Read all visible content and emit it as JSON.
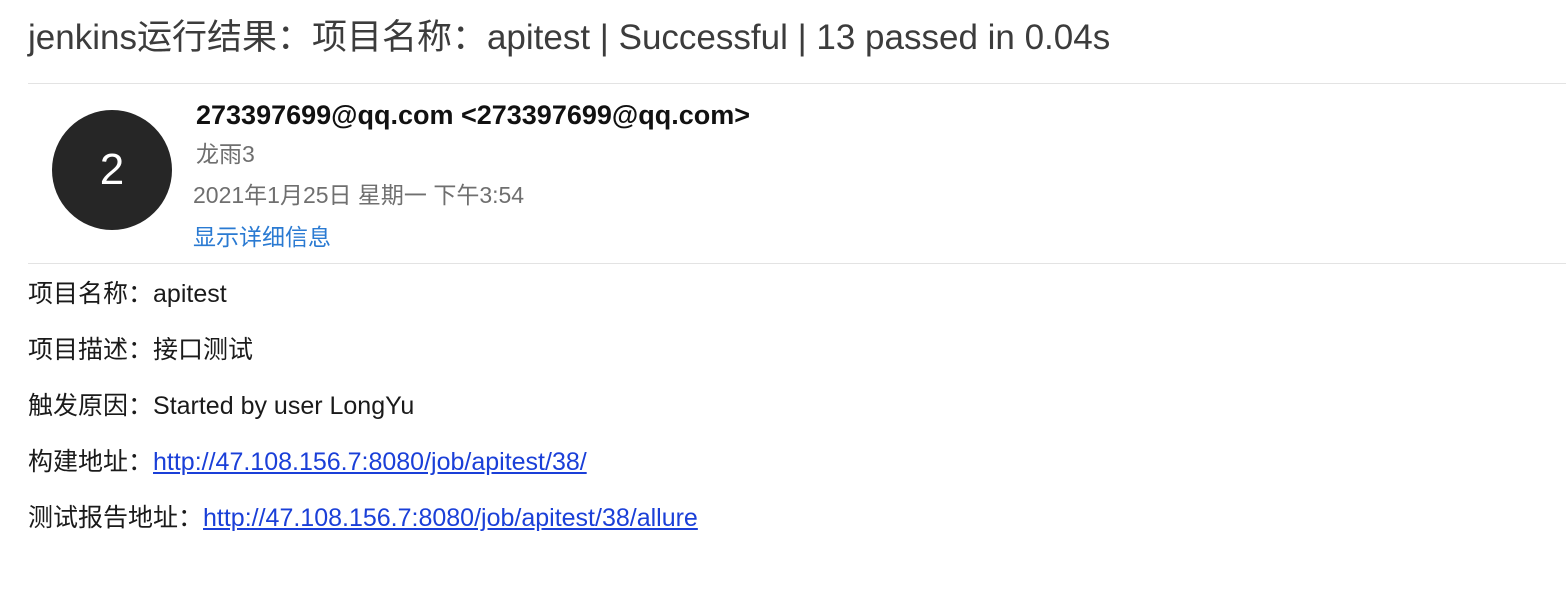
{
  "email": {
    "subject": "jenkins运行结果：项目名称：apitest | Successful | 13 passed in 0.04s",
    "avatar_initial": "2",
    "sender": "273397699@qq.com <273397699@qq.com>",
    "recipient": "龙雨3",
    "date": "2021年1月25日 星期一 下午3:54",
    "show_details_label": "显示详细信息"
  },
  "body": {
    "project_name": {
      "label": "项目名称：",
      "value": "apitest"
    },
    "project_desc": {
      "label": "项目描述：",
      "value": "接口测试"
    },
    "trigger": {
      "label": "触发原因：",
      "value": "Started by user LongYu"
    },
    "build_url": {
      "label": "构建地址：",
      "value": "http://47.108.156.7:8080/job/apitest/38/"
    },
    "report_url": {
      "label": "测试报告地址：",
      "value": "http://47.108.156.7:8080/job/apitest/38/allure"
    }
  },
  "colors": {
    "avatar_bg": "#262626",
    "link": "#1a3fd8",
    "details_link": "#2a7ad2",
    "meta_text": "#6f6f6f"
  }
}
